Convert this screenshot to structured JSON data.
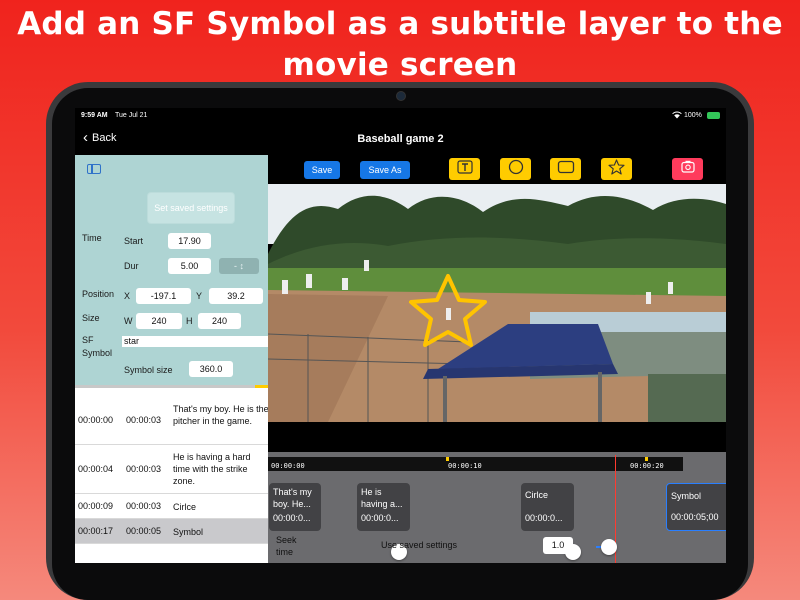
{
  "headline": "Add an SF Symbol as a subtitle layer to the movie screen",
  "status": {
    "time": "9:59 AM",
    "date": "Tue Jul 21",
    "battery": "100%"
  },
  "nav": {
    "back_label": "Back",
    "title": "Baseball game 2"
  },
  "settings": {
    "set_saved_label": "Set saved settings",
    "time_label": "Time",
    "start_label": "Start",
    "start_value": "17.90",
    "dur_label": "Dur",
    "dur_value": "5.00",
    "stepper_label": "- ↕",
    "position_label": "Position",
    "x_label": "X",
    "x_value": "-197.1",
    "y_label": "Y",
    "y_value": "39.2",
    "size_label": "Size",
    "w_label": "W",
    "w_value": "240",
    "h_label": "H",
    "h_value": "240",
    "sf_symbol_label_1": "SF",
    "sf_symbol_label_2": "Symbol",
    "sf_symbol_value": "star",
    "symbol_size_label": "Symbol size",
    "symbol_size_value": "360.0"
  },
  "subtitles": [
    {
      "start": "00:00:00",
      "dur": "00:00:03",
      "text": "That's my boy.  He is the pitcher in the game."
    },
    {
      "start": "00:00:04",
      "dur": "00:00:03",
      "text": "He is having a hard time with the strike zone."
    },
    {
      "start": "00:00:09",
      "dur": "00:00:03",
      "text": "Cirlce"
    },
    {
      "start": "00:00:17",
      "dur": "00:00:05",
      "text": "Symbol"
    }
  ],
  "toolbar": {
    "save_label": "Save",
    "save_as_label": "Save As",
    "icons": [
      "text-icon",
      "circle-icon",
      "rectangle-icon",
      "star-icon",
      "camera-icon"
    ],
    "accent": "#ffcc00",
    "blue": "#1677e6",
    "red": "#ff3b5c"
  },
  "overlay": {
    "symbol": "star",
    "color": "#ffc400"
  },
  "timeline": {
    "ruler_labels": [
      "00:00:00",
      "00:00:10",
      "00:00:20"
    ],
    "clips": [
      {
        "title": "That's my boy.  He...",
        "time": "00:00:0..."
      },
      {
        "title": "He is having a...",
        "time": "00:00:0..."
      },
      {
        "title": "Cirlce",
        "time": "00:00:0..."
      },
      {
        "title": "Symbol",
        "time": "00:00:05;00"
      }
    ],
    "seek_label_1": "Seek",
    "seek_label_2": "time",
    "use_saved_label": "Use saved settings",
    "speed_value": "1.0"
  }
}
